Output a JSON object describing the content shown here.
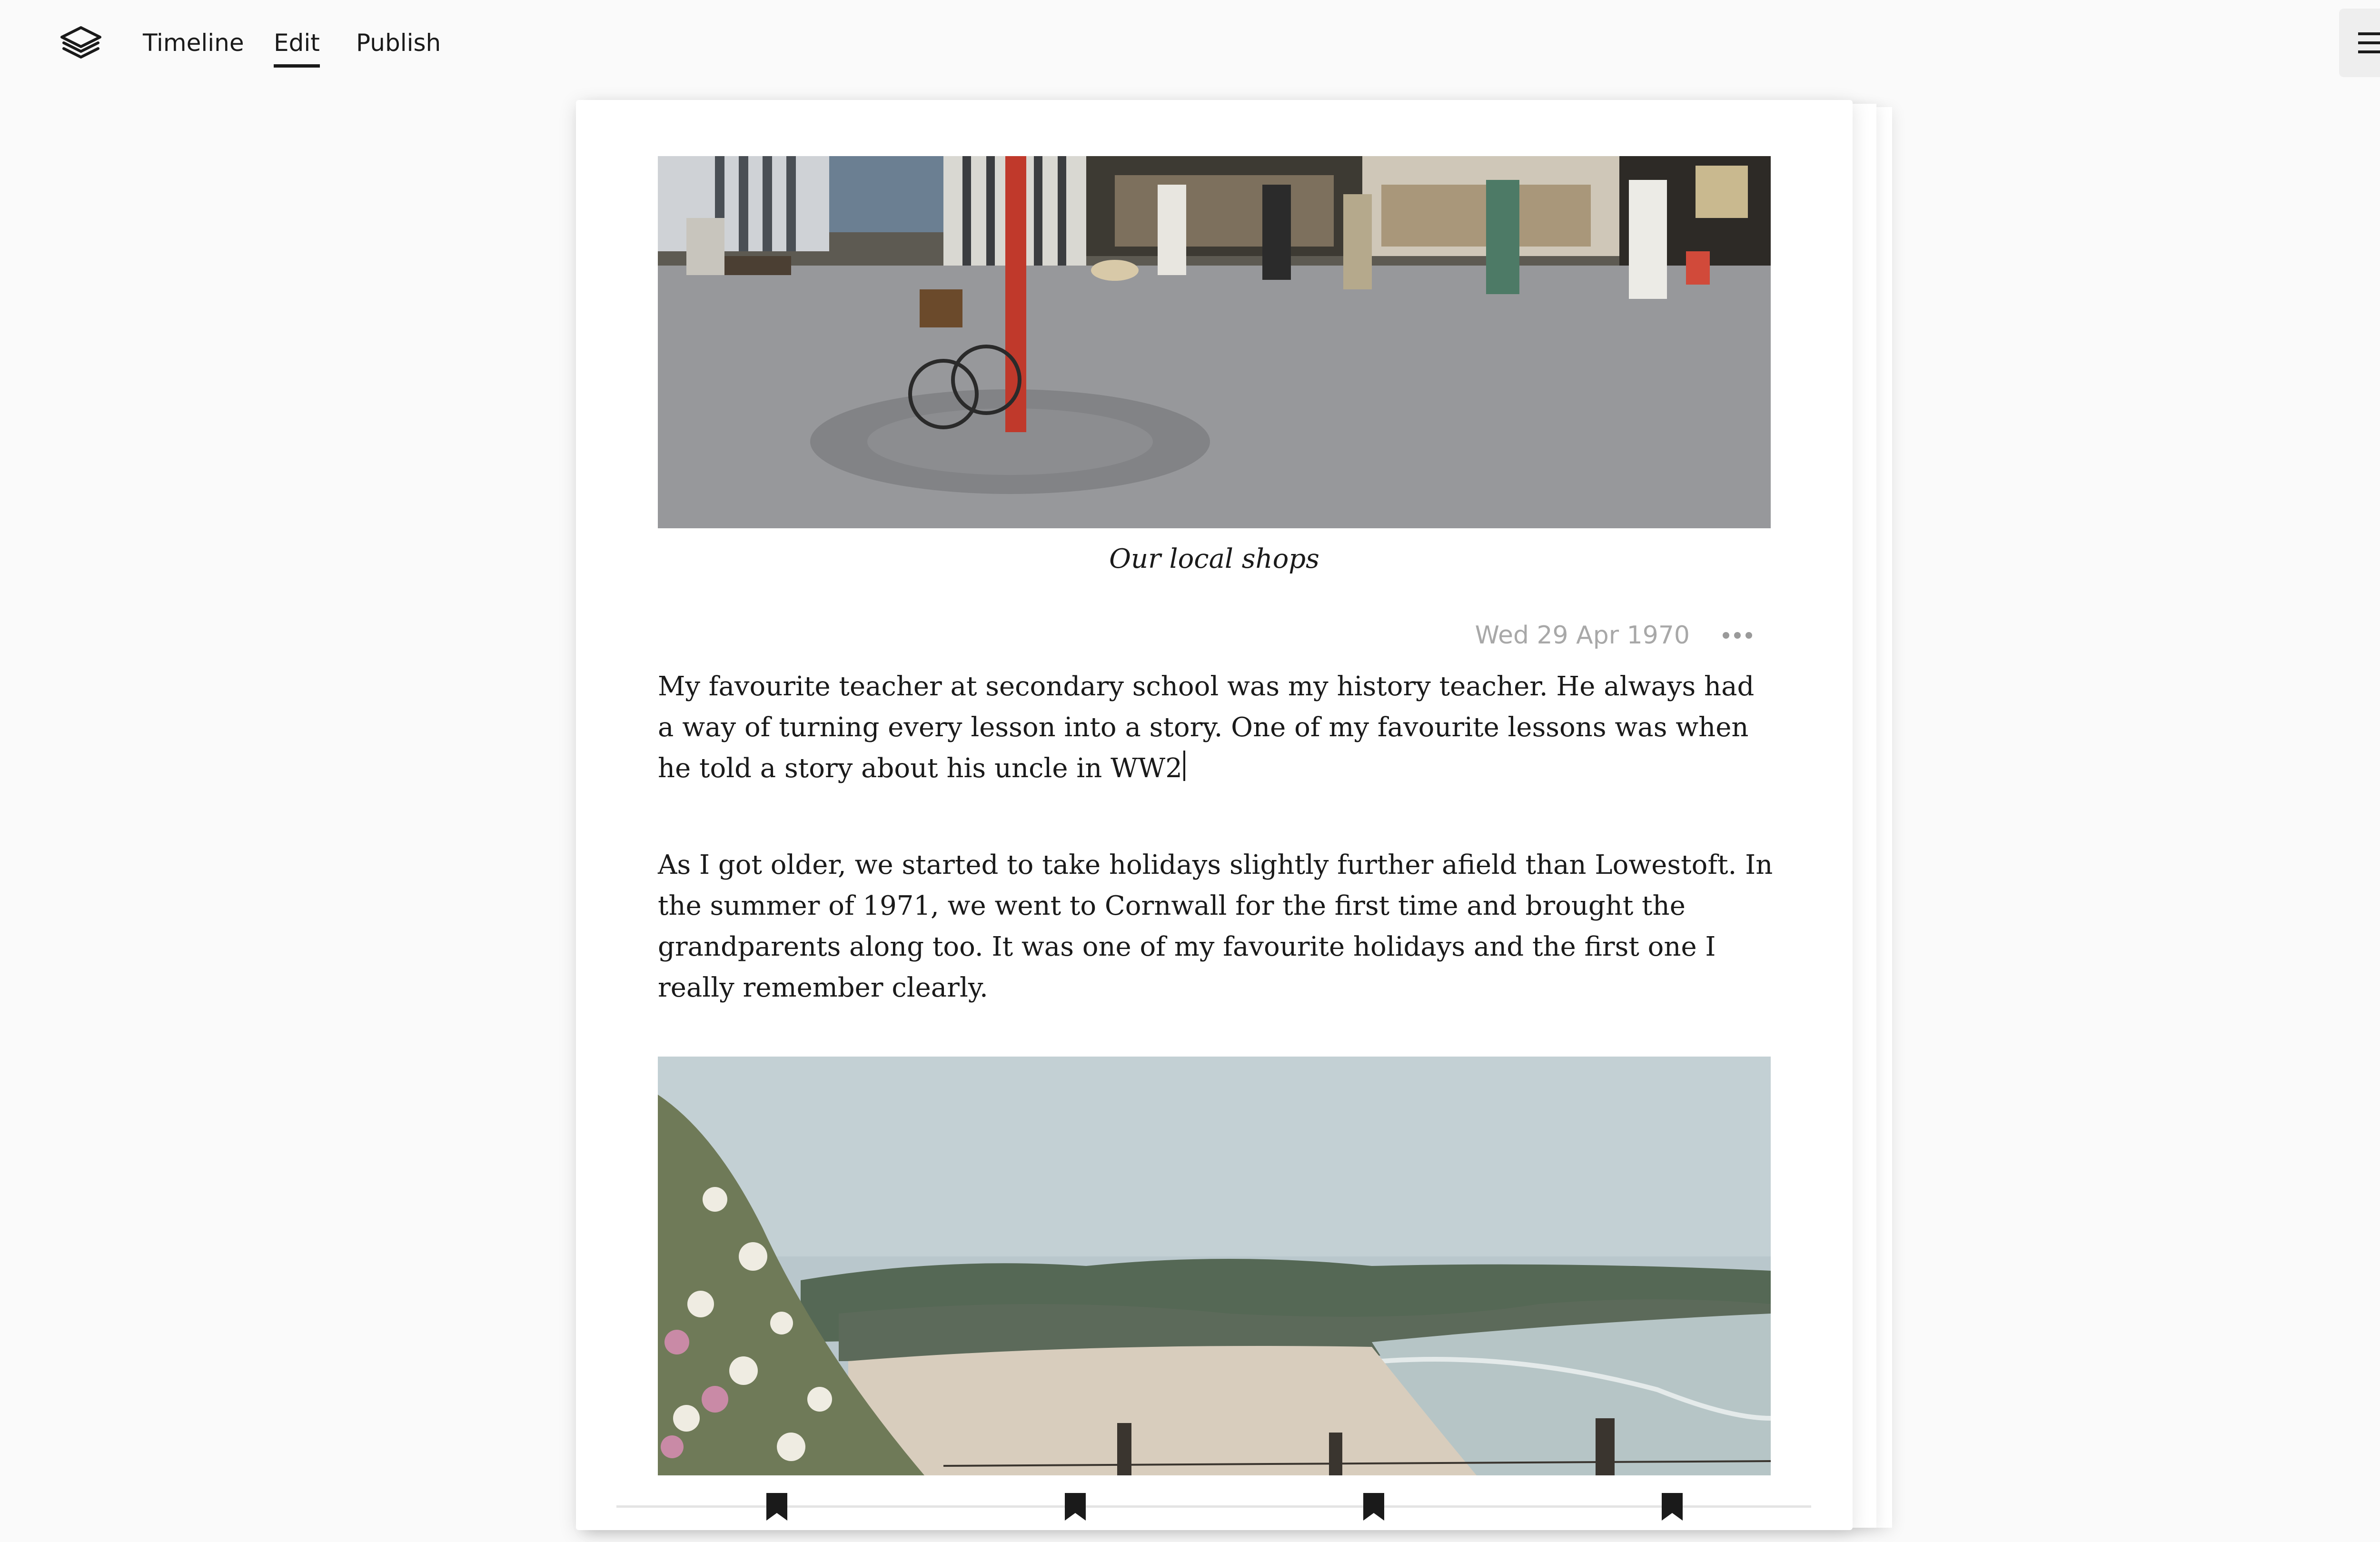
{
  "nav": {
    "logo_icon": "stacked-layers-icon",
    "links": [
      {
        "label": "Timeline",
        "active": false
      },
      {
        "label": "Edit",
        "active": true
      },
      {
        "label": "Publish",
        "active": false
      }
    ],
    "menu_icon": "hamburger-menu-icon"
  },
  "story": {
    "top_photo": {
      "caption": "Our local shops"
    },
    "entry": {
      "date": "Wed 29 Apr 1970",
      "more_icon": "more-dots-icon",
      "paragraphs": [
        "My favourite teacher at secondary school was my history teacher. He always had a way of turning every lesson into a story. One of my favourite lessons was when he told a story about his uncle in WW2",
        "As I got older, we started to take holidays slightly further afield than Lowestoft. In the summer of 1971, we went to Cornwall for the first time and brought the grandparents along too. It was one of my favourite holidays and the first one I really remember clearly."
      ]
    },
    "bottom_photo": {
      "caption": ""
    }
  },
  "toolbar": {
    "bookmarks": [
      {
        "icon": "bookmark-icon"
      },
      {
        "icon": "bookmark-icon"
      },
      {
        "icon": "bookmark-icon"
      },
      {
        "icon": "bookmark-icon"
      }
    ]
  },
  "colors": {
    "background": "#fafafa",
    "page": "#ffffff",
    "text": "#1a1a1a",
    "date_text": "#a8a8a8"
  }
}
